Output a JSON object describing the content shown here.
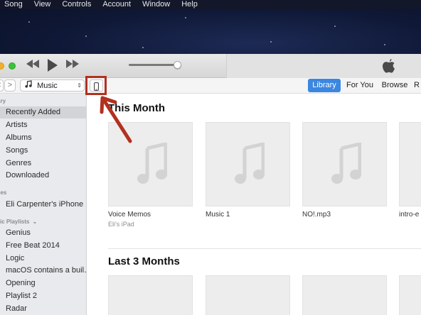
{
  "menubar": {
    "items": [
      "Song",
      "View",
      "Controls",
      "Account",
      "Window",
      "Help"
    ]
  },
  "toolbar": {
    "back": "<",
    "forward": ">",
    "media_kind": "Music",
    "tabs": [
      {
        "label": "Library",
        "active": true
      },
      {
        "label": "For You",
        "active": false
      },
      {
        "label": "Browse",
        "active": false
      },
      {
        "label": "R",
        "active": false
      }
    ]
  },
  "sidebar": {
    "library_header": "ary",
    "library_items": [
      "Recently Added",
      "Artists",
      "Albums",
      "Songs",
      "Genres",
      "Downloaded"
    ],
    "selected": "Recently Added",
    "devices_header": "ces",
    "devices": [
      "Eli Carpenter's iPhone"
    ],
    "playlists_header": "ic Playlists",
    "playlists": [
      "Genius",
      "Free Beat 2014",
      "Logic",
      "macOS contains a buil…",
      "Opening",
      "Playlist 2",
      "Radar"
    ]
  },
  "main": {
    "this_month_title": "This Month",
    "this_month_items": [
      {
        "title": "Voice Memos",
        "subtitle": "Eli's iPad"
      },
      {
        "title": "Music 1",
        "subtitle": ""
      },
      {
        "title": "NO!.mp3",
        "subtitle": ""
      },
      {
        "title": "intro-e",
        "subtitle": ""
      }
    ],
    "last3_title": "Last 3 Months"
  },
  "colors": {
    "accent": "#3b87e0",
    "annotation": "#b2311f",
    "sidebar_bg": "#e9eaed"
  },
  "icons": [
    "apple-logo-icon",
    "rewind-icon",
    "play-icon",
    "fast-forward-icon",
    "music-note-icon",
    "iphone-icon",
    "annotation-arrow"
  ]
}
